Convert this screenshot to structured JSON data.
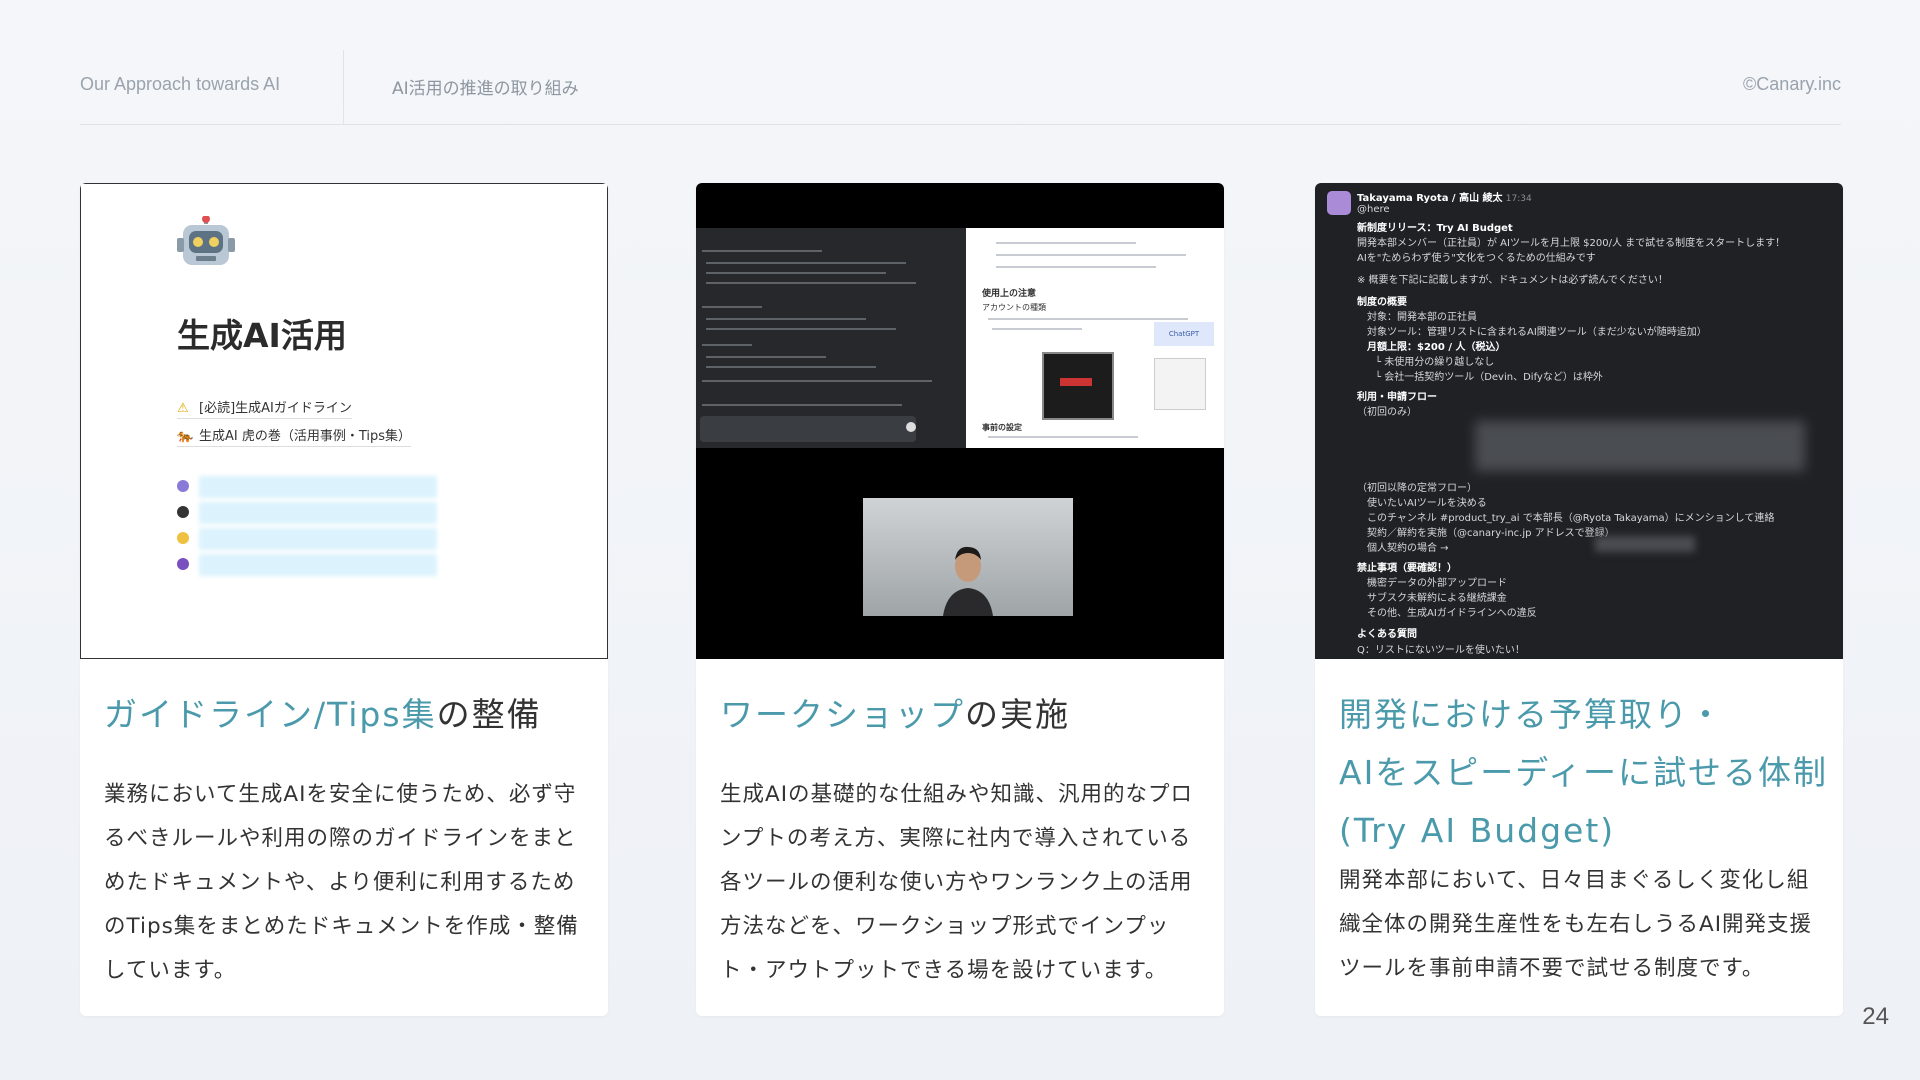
{
  "header": {
    "left": "Our Approach  towards AI",
    "middle": "AI活用の推進の取り組み",
    "right": "©Canary.inc"
  },
  "cards": [
    {
      "title": "ガイドライン/Tips集の整備",
      "title_accent": "ガイドライン/Tips集",
      "title_rest": "の整備",
      "body": "業務において生成AIを安全に使うため、必ず守るべきルールや利用の際のガイドラインをまとめたドキュメントや、より便利に利用するためのTips集をまとめたドキュメントを作成・整備しています。",
      "screenshot": {
        "doc_title": "生成AI活用",
        "links": [
          "[必読]生成AIガイドライン",
          "生成AI 虎の巻（活用事例・Tips集）"
        ],
        "link_icons": [
          "warning-icon",
          "tiger-icon"
        ],
        "blurred_item_icons": [
          "rocket-icon",
          "hat-icon",
          "sparkles-icon",
          "crystal-ball-icon"
        ]
      }
    },
    {
      "title_accent": "ワークショップ",
      "title_rest": "の実施",
      "body": "生成AIの基礎的な仕組みや知識、汎用的なプロンプトの考え方、実際に社内で導入されている各ツールの便利な使い方やワンランク上の活用方法などを、ワークショップ形式でインプット・アウトプットできる場を設けています。",
      "screenshot": {
        "right_heading": "使用上の注意",
        "right_sub": "アカウントの種類",
        "right_heading2": "事前の設定",
        "chip": "ChatGPT"
      }
    },
    {
      "title_accent_line1": "開発における予算取り・",
      "title_accent_line2": "AIをスピーディーに試せる体制",
      "title_accent_line3": "(Try AI Budget)",
      "body": "開発本部において、日々目まぐるしく変化し組織全体の開発生産性をも左右しうるAI開発支援ツールを事前申請不要で試せる制度です。",
      "screenshot": {
        "author": "Takayama Ryota / 高山 綾太",
        "time": "17:34",
        "lines": [
          "@here",
          "新制度リリース：Try AI Budget",
          "開発本部メンバー（正社員）が AIツールを月上限 $200/人 まで試せる制度をスタートします！",
          "AIを\"ためらわず使う\"文化をつくるための仕組みです",
          "※ 概要を下記に記載しますが、ドキュメントは必ず読んでください！",
          "制度の概要",
          "対象：開発本部の正社員",
          "対象ツール：管理リストに含まれるAI関連ツール（まだ少ないが随時追加）",
          "月額上限：$200 / 人（税込）",
          "└ 未使用分の繰り越しなし",
          "└ 会社一括契約ツール（Devin、Difyなど）は枠外",
          "利用・申請フロー",
          "（初回のみ）",
          "（初回以降の定常フロー）",
          "使いたいAIツールを決める",
          "このチャンネル #product_try_ai で本部長（@Ryota Takayama）にメンションして連絡",
          "契約／解約を実施（@canary-inc.jp アドレスで登録）",
          "個人契約の場合 →",
          "禁止事項（要確認！）",
          "機密データの外部アップロード",
          "サブスク未解約による継続課金",
          "その他、生成AIガイドラインへの違反",
          "よくある質問",
          "Q：リストにないツールを使いたい！"
        ]
      }
    }
  ],
  "page_number": "24"
}
